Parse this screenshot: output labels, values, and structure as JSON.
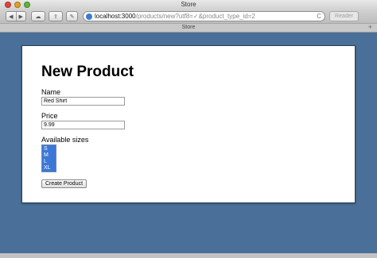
{
  "window": {
    "title": "Store"
  },
  "toolbar": {
    "url_host": "localhost:3000",
    "url_path": "/products/new?utf8=✓&product_type_id=2",
    "reader_label": "Reader",
    "back_glyph": "◀",
    "forward_glyph": "▶",
    "reload_glyph": "C",
    "cloud_glyph": "☁",
    "share_glyph": "⇪",
    "wrench_glyph": "✎",
    "plus_glyph": "+"
  },
  "tab": {
    "title": "Store"
  },
  "form": {
    "heading": "New Product",
    "name_label": "Name",
    "name_value": "Red Shirt",
    "price_label": "Price",
    "price_value": "9.99",
    "sizes_label": "Available sizes",
    "sizes": [
      "S",
      "M",
      "L",
      "XL"
    ],
    "submit_label": "Create Product"
  },
  "colors": {
    "background": "#4a6f98",
    "selection": "#3b78d6"
  }
}
